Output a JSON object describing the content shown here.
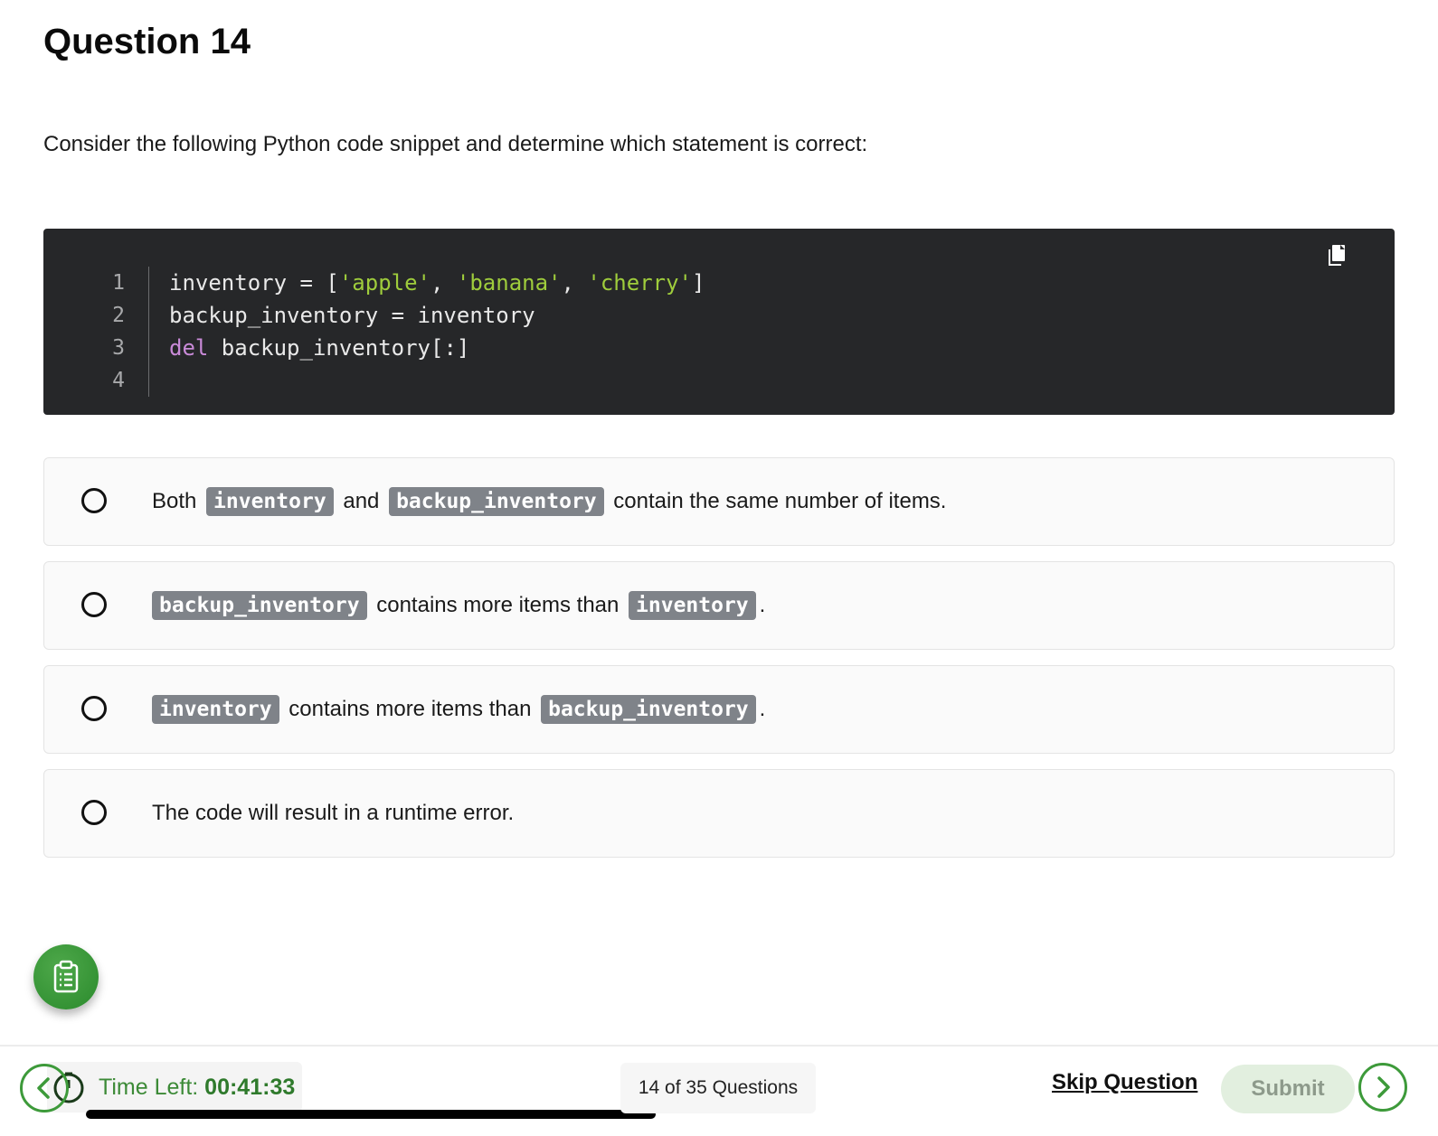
{
  "question": {
    "title": "Question 14",
    "prompt": "Consider the following Python code snippet and determine which statement is correct:"
  },
  "code": {
    "line_numbers": [
      "1",
      "2",
      "3",
      "4"
    ],
    "lines": [
      [
        {
          "t": "inventory = [",
          "k": "plain"
        },
        {
          "t": "'apple'",
          "k": "str"
        },
        {
          "t": ", ",
          "k": "plain"
        },
        {
          "t": "'banana'",
          "k": "str"
        },
        {
          "t": ", ",
          "k": "plain"
        },
        {
          "t": "'cherry'",
          "k": "str"
        },
        {
          "t": "]",
          "k": "plain"
        }
      ],
      [
        {
          "t": "backup_inventory = inventory",
          "k": "plain"
        }
      ],
      [
        {
          "t": "del",
          "k": "kw"
        },
        {
          "t": " backup_inventory[:]",
          "k": "plain"
        }
      ],
      []
    ],
    "copy_icon": "copy-icon"
  },
  "options": [
    {
      "parts": [
        {
          "t": "Both ",
          "c": false
        },
        {
          "t": "inventory",
          "c": true
        },
        {
          "t": " and ",
          "c": false
        },
        {
          "t": "backup_inventory",
          "c": true
        },
        {
          "t": " contain the same number of items.",
          "c": false
        }
      ]
    },
    {
      "parts": [
        {
          "t": "backup_inventory",
          "c": true
        },
        {
          "t": " contains more items than ",
          "c": false
        },
        {
          "t": "inventory",
          "c": true
        },
        {
          "t": ".",
          "c": false
        }
      ]
    },
    {
      "parts": [
        {
          "t": "inventory",
          "c": true
        },
        {
          "t": " contains more items than ",
          "c": false
        },
        {
          "t": "backup_inventory",
          "c": true
        },
        {
          "t": ".",
          "c": false
        }
      ]
    },
    {
      "parts": [
        {
          "t": "The code will result in a runtime error.",
          "c": false
        }
      ]
    }
  ],
  "footer": {
    "time_label": "Time Left: ",
    "time_value": "00:41:33",
    "progress": 0.4,
    "question_count": "14 of 35 Questions",
    "skip_label": "Skip Question",
    "submit_label": "Submit"
  },
  "colors": {
    "accent_green": "#3d9a3a",
    "code_bg": "#262729",
    "code_string": "#9fcd3c",
    "code_keyword": "#c98ad8",
    "chip_bg": "#7f8389",
    "submit_bg_disabled": "#e2efdf"
  }
}
